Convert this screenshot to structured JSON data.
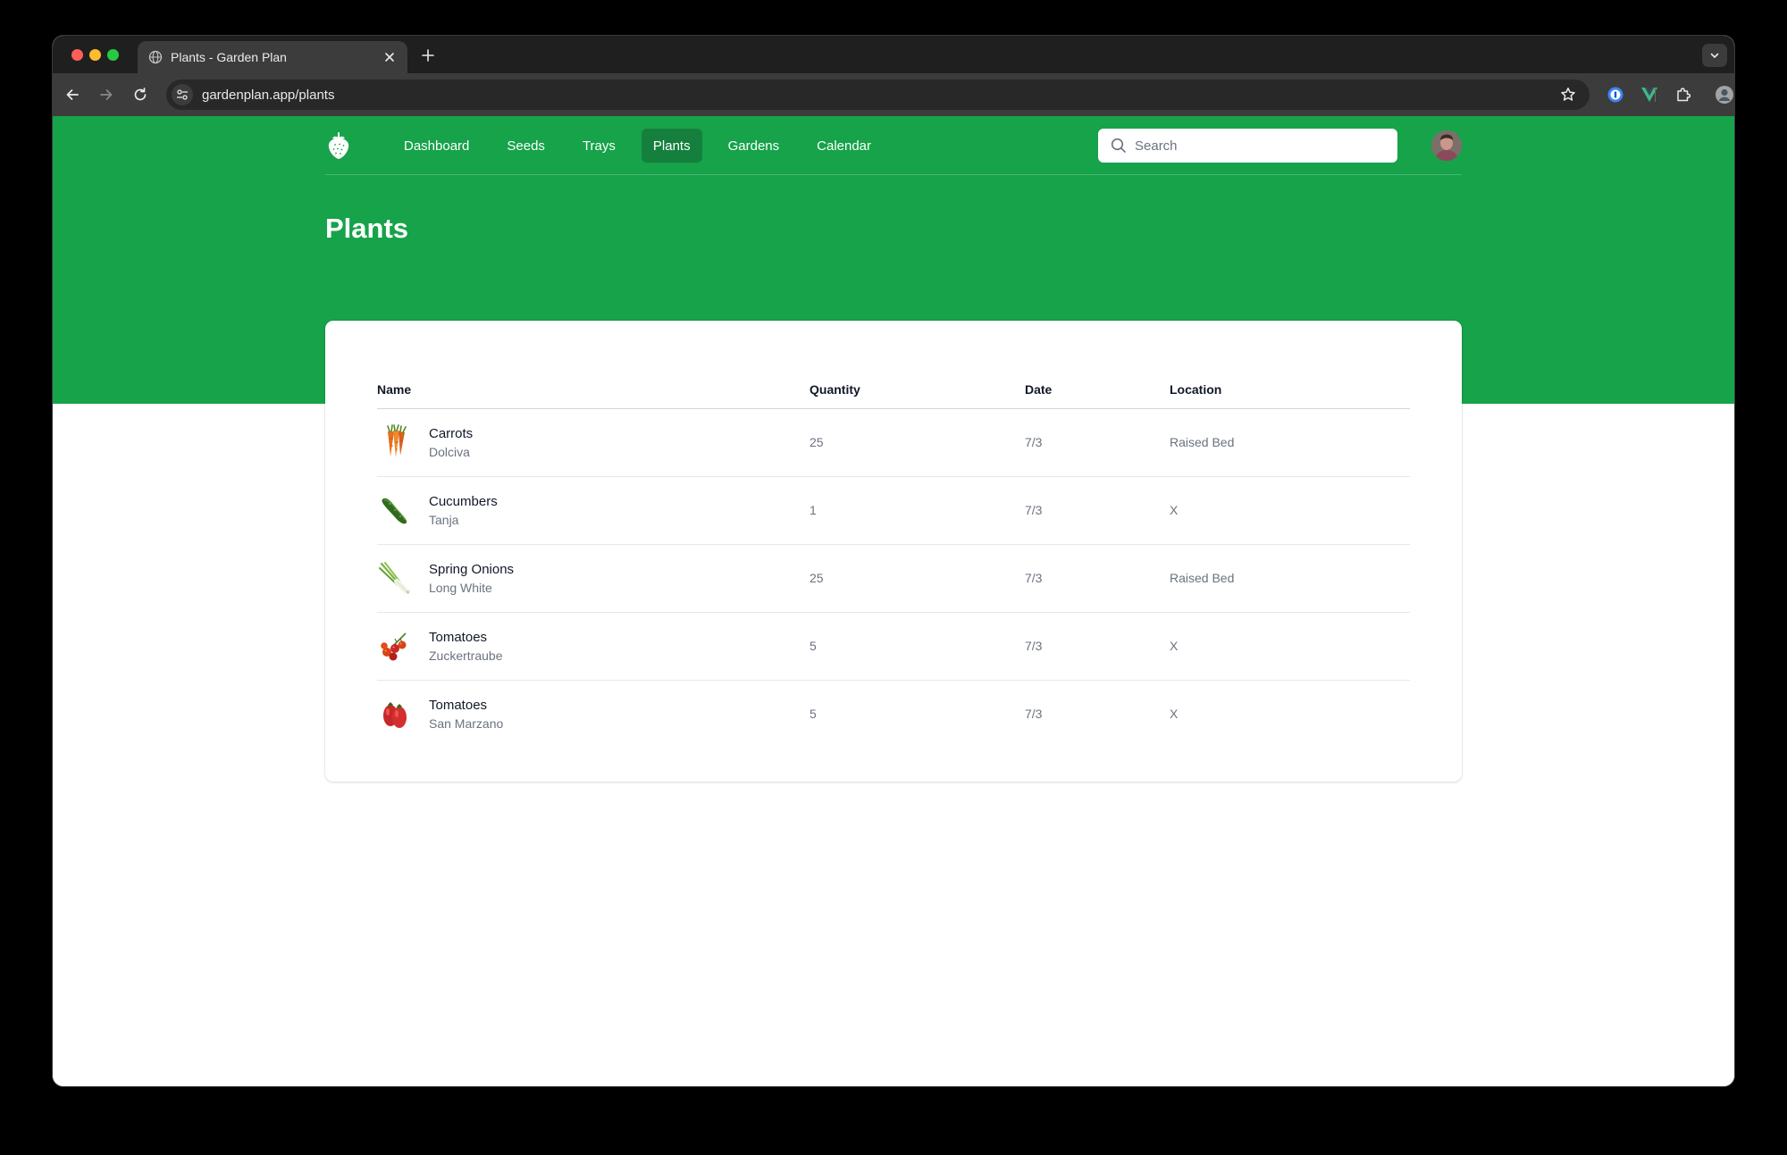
{
  "browser": {
    "tab_title": "Plants - Garden Plan",
    "url": "gardenplan.app/plants"
  },
  "nav": {
    "items": [
      {
        "label": "Dashboard",
        "active": false
      },
      {
        "label": "Seeds",
        "active": false
      },
      {
        "label": "Trays",
        "active": false
      },
      {
        "label": "Plants",
        "active": true
      },
      {
        "label": "Gardens",
        "active": false
      },
      {
        "label": "Calendar",
        "active": false
      }
    ],
    "search_placeholder": "Search"
  },
  "page": {
    "title": "Plants"
  },
  "table": {
    "headers": {
      "name": "Name",
      "quantity": "Quantity",
      "date": "Date",
      "location": "Location"
    },
    "rows": [
      {
        "name": "Carrots",
        "variety": "Dolciva",
        "quantity": "25",
        "date": "7/3",
        "location": "Raised Bed",
        "icon": "carrot-icon"
      },
      {
        "name": "Cucumbers",
        "variety": "Tanja",
        "quantity": "1",
        "date": "7/3",
        "location": "X",
        "icon": "cucumber-icon"
      },
      {
        "name": "Spring Onions",
        "variety": "Long White",
        "quantity": "25",
        "date": "7/3",
        "location": "Raised Bed",
        "icon": "spring-onion-icon"
      },
      {
        "name": "Tomatoes",
        "variety": "Zuckertraube",
        "quantity": "5",
        "date": "7/3",
        "location": "X",
        "icon": "cherry-tomato-icon"
      },
      {
        "name": "Tomatoes",
        "variety": "San Marzano",
        "quantity": "5",
        "date": "7/3",
        "location": "X",
        "icon": "plum-tomato-icon"
      }
    ]
  },
  "colors": {
    "brand": "#16a34a",
    "nav_active": "#15803d"
  }
}
